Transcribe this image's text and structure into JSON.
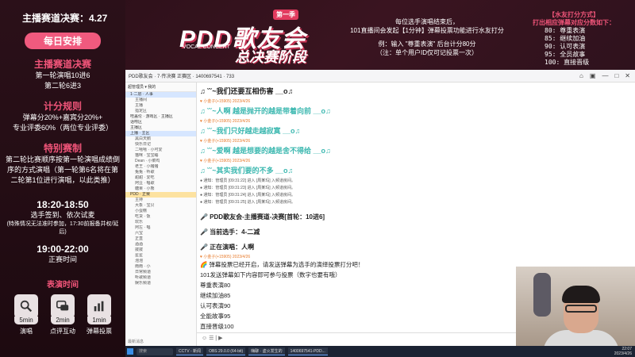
{
  "left": {
    "header": "主播赛道决赛：4.27",
    "daily_badge": "每日安排",
    "main_track_title": "主播赛道决赛",
    "main_track_lines": [
      "第一轮演唱10进6",
      "第二轮6进3"
    ],
    "score_title": "计分规则",
    "score_lines": [
      "弹幕分20%+嘉宾分20%+",
      "专业评委60%（两位专业评委）"
    ],
    "special_title": "特别赛制",
    "special_lines": [
      "第二轮比赛顺序按第一轮演唱成绩倒",
      "序的方式演唱（第一轮第6名将在第",
      "二轮第1位进行演唱，以此类推）"
    ],
    "time1": "18:20-18:50",
    "time1_desc": "选手签到、依次试麦",
    "time1_note": "(特殊情况无法准时参加，17:30前报备并权/延后)",
    "time2": "19:00-22:00",
    "time2_desc": "正赛时间",
    "perf_title": "表演时间",
    "perf_items": [
      {
        "icon": "microphone-icon",
        "time": "5min",
        "label": "演唱"
      },
      {
        "icon": "comment-icon",
        "time": "2min",
        "label": "点评互动"
      },
      {
        "icon": "vote-chart-icon",
        "time": "1min",
        "label": "弹幕投票"
      }
    ]
  },
  "banner": {
    "season": "第一季",
    "logo_main": "PDD歌友会",
    "logo_sub": "VOCAL CONCERT",
    "stage": "总决赛阶段",
    "mid_rules": [
      "每位选手演唱结束后，",
      "101直播间会发起【1分钟】弹幕投票功能进行水友打分",
      "",
      "例：输入 \"尊重表演\" 后台计分80分",
      "（注：单个用户ID仅可记投票一次）"
    ],
    "right_title": "【水友打分方式】",
    "right_subtitle": "打出相应弹幕对应分数如下：",
    "right_codes": [
      "80: 尊重表演",
      "85: 继续加油",
      "90: 认可表演",
      "95: 全员故事",
      "100: 直接晋级"
    ]
  },
  "window": {
    "title": "PDD歌友会 · 7·传决赛 正赛区 · 1400697541 · 733",
    "controls": [
      "⌂",
      "▣",
      "—",
      "□",
      "✕"
    ]
  },
  "sidebar": {
    "head": "超管理员 ▾  我的",
    "channels": [
      {
        "label": "1·二层 · 人事",
        "type": "sel"
      },
      {
        "label": "主播间",
        "type": "ch"
      },
      {
        "label": "主播",
        "type": "ch"
      },
      {
        "label": "指定区",
        "type": "ch"
      },
      {
        "label": "哇盖伦 · 游戏区  · 主播区",
        "type": "row"
      },
      {
        "label": "话唠区",
        "type": "row"
      },
      {
        "label": "主播区",
        "type": "row"
      },
      {
        "label": "上播 · 主区",
        "type": "sel"
      },
      {
        "label": "黑白天鹅",
        "type": "ch"
      },
      {
        "label": "快乐日记",
        "type": "ch"
      },
      {
        "label": "二嘻嘻 · 小可爱",
        "type": "ch"
      },
      {
        "label": "猫咪 · 宝宝睡",
        "type": "ch"
      },
      {
        "label": "Dean · 小菜鸡",
        "type": "ch"
      },
      {
        "label": "老王 · 小猪猪",
        "type": "ch"
      },
      {
        "label": "兔兔 · 听歌",
        "type": "ch"
      },
      {
        "label": "甜甜 · 爱吃",
        "type": "ch"
      },
      {
        "label": "阿豆 · 唱歌",
        "type": "ch"
      },
      {
        "label": "糖果 · 小熊",
        "type": "ch"
      },
      {
        "label": "PDD · 正赛",
        "type": "hi"
      },
      {
        "label": "主持",
        "type": "ch"
      },
      {
        "label": "大象 · 宝贝",
        "type": "ch"
      },
      {
        "label": "小蛋糕",
        "type": "ch"
      },
      {
        "label": "吃货 · 饭",
        "type": "ch"
      },
      {
        "label": "欢乐",
        "type": "ch"
      },
      {
        "label": "阿左 · 唱",
        "type": "ch"
      },
      {
        "label": "六宝",
        "type": "ch"
      },
      {
        "label": "正直",
        "type": "ch"
      },
      {
        "label": "酒酒",
        "type": "ch"
      },
      {
        "label": "拨拨",
        "type": "ch"
      },
      {
        "label": "星星",
        "type": "ch"
      },
      {
        "label": "泡泡",
        "type": "ch"
      },
      {
        "label": "雨雨 · 小",
        "type": "ch"
      },
      {
        "label": "日常频道",
        "type": "ch"
      },
      {
        "label": "听歌频道",
        "type": "ch"
      },
      {
        "label": "娱乐频道",
        "type": "ch"
      }
    ],
    "footer": "最新消息"
  },
  "chat": {
    "lines": [
      {
        "kind": "big",
        "text": "♫ ˘˘~我们还要互相伤害 __o♫",
        "color": "dark"
      },
      {
        "kind": "meta",
        "text": "♥ 小金子(+15905) 2023/4/26"
      },
      {
        "kind": "big",
        "text": "♫ ˘˘~人啊    越是抛开的越是带着向前 __o♫",
        "color": "teal"
      },
      {
        "kind": "meta",
        "text": "♥ 小金子(+15905) 2023/4/26"
      },
      {
        "kind": "big",
        "text": "♫ ˘˘~我们只好越走越寂寞 __o♫",
        "color": "teal"
      },
      {
        "kind": "meta",
        "text": "♥ 小金子(+15905) 2023/4/26"
      },
      {
        "kind": "big",
        "text": "♫ ˘˘~爱啊    越是想要的越是舍不得给 __o♫",
        "color": "teal"
      },
      {
        "kind": "meta",
        "text": "♥ 小金子(+15905) 2023/4/26"
      },
      {
        "kind": "big",
        "text": "♫ ˘˘~其实我们要的不多 __o♫",
        "color": "teal"
      }
    ],
    "system": [
      "● 通知：管理员 [09:31:22] 进入 [周某玛] 入频道房间。",
      "● 通知：管理员 [09:31:23] 进入 [周某玛] 入频道房间。",
      "● 通知：管理员 [09:31:24] 进入 [周某玛] 入频道房间。",
      "● 通知：管理员 [09:31:25] 进入 [周某玛] 入频道房间。"
    ],
    "announcements": [
      "🎤 PDD歌友会-主播赛道-决赛[首轮：10进6]",
      "🎤 当前选手：4-二减",
      "🎤 正在演唱：人啊"
    ],
    "vote_meta": "♥ 小金子(+15905) 2023/4/26",
    "vote_lines": [
      "🌈 弹幕投票已经开启，请发送弹幕为选手的演绎投票打分吧！",
      "101发送弹幕如下内容即可参与投票（数字也要有哦）",
      "尊重表演80",
      "继续加油85",
      "认可表演90",
      "全能故事95",
      "直接晋级100"
    ],
    "input_hint": "☺ ☰  |  ▶"
  },
  "taskbar": {
    "search": "搜索",
    "apps": [
      "CCTV - 新闻",
      "OBS 29.0.0 (64-bit)",
      "嗨聊 · 虚火发生的",
      "1400697541-PDD..."
    ],
    "clock": [
      "22:07",
      "2023/4/26"
    ]
  },
  "colors": {
    "accent": "#f2557a",
    "teal": "#3cb8b0",
    "bg": "#2a0f18"
  }
}
